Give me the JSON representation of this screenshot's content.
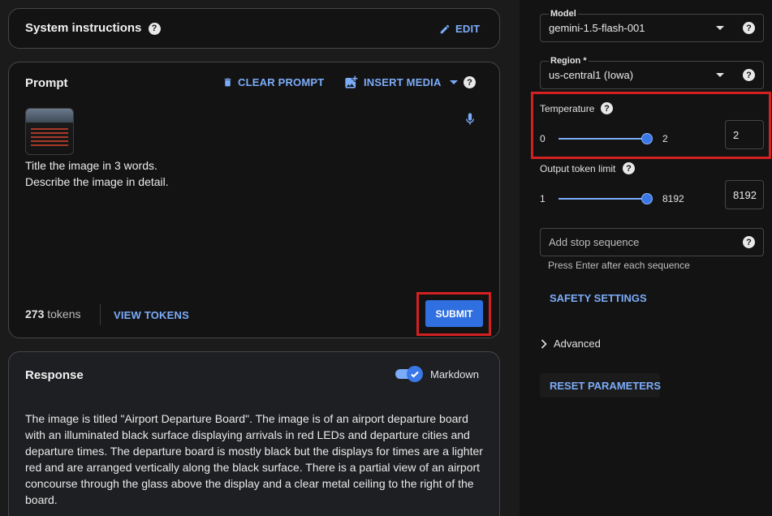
{
  "system_instructions": {
    "title": "System instructions",
    "edit_label": "EDIT"
  },
  "prompt": {
    "title": "Prompt",
    "clear_label": "CLEAR PROMPT",
    "insert_label": "INSERT MEDIA",
    "text_line1": "Title the image in 3 words.",
    "text_line2": "Describe the image in detail.",
    "token_count": "273",
    "token_unit": "tokens",
    "view_tokens_label": "VIEW TOKENS",
    "submit_label": "SUBMIT"
  },
  "response": {
    "title": "Response",
    "markdown_label": "Markdown",
    "markdown_enabled": true,
    "text": "The image is titled \"Airport Departure Board\". The image is of an airport departure board with an illuminated black surface displaying arrivals in red LEDs and departure cities and departure times. The departure board is mostly black but the displays for times are a lighter red and are arranged vertically along the black surface. There is a partial view of an airport concourse through the glass above the display and a clear metal ceiling to the right of the board."
  },
  "settings": {
    "model_label": "Model",
    "model_value": "gemini-1.5-flash-001",
    "region_label": "Region *",
    "region_value": "us-central1 (Iowa)",
    "temperature_label": "Temperature",
    "temperature_min": "0",
    "temperature_max": "2",
    "temperature_value": "2",
    "output_label": "Output token limit",
    "output_min": "1",
    "output_max": "8192",
    "output_value": "8192",
    "stop_placeholder": "Add stop sequence",
    "stop_hint": "Press Enter after each sequence",
    "safety_label": "SAFETY SETTINGS",
    "advanced_label": "Advanced",
    "reset_label": "RESET PARAMETERS"
  },
  "colors": {
    "accent": "#7cacf8",
    "submit": "#2f6fe0",
    "highlight": "#d32020"
  }
}
